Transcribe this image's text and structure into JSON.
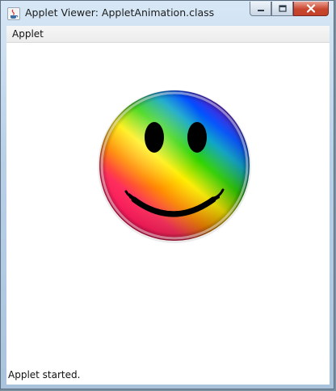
{
  "window": {
    "title": "Applet Viewer: AppletAnimation.class",
    "controls": {
      "minimize_icon": "minimize-icon",
      "maximize_icon": "maximize-icon",
      "close_icon": "close-icon"
    }
  },
  "menubar": {
    "items": [
      {
        "label": "Applet"
      }
    ]
  },
  "canvas": {
    "image": "rainbow-smiley-face",
    "gradient_colors": [
      "#ff0044",
      "#ff7a00",
      "#ffee00",
      "#1fd000",
      "#0066ff",
      "#6a00c8"
    ]
  },
  "status": {
    "text": "Applet started."
  }
}
